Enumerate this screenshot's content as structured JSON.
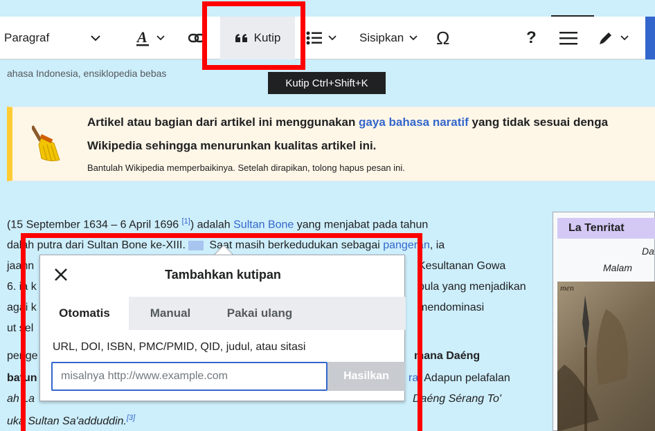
{
  "toolbar": {
    "paragraph_label": "Paragraf",
    "cite_label": "Kutip",
    "insert_label": "Sisipkan",
    "special_char_label": "Ω",
    "help_label": "?",
    "accent_color": "#3366cc"
  },
  "tooltip": {
    "text": "Kutip Ctrl+Shift+K"
  },
  "subtitle": "ahasa Indonesia, ensiklopedia bebas",
  "notice": {
    "line1_pre": "Artikel atau bagian dari artikel ini menggunakan ",
    "line1_link": "gaya bahasa naratif",
    "line1_post": " yang tidak sesuai denga",
    "line2": "Wikipedia sehingga menurunkan kualitas artikel ini.",
    "line3": "Bantulah Wikipedia memperbaikinya. Setelah dirapikan, tolong hapus pesan ini."
  },
  "article": {
    "line1_a": "(15 September 1634 – 6 April 1696 ",
    "line1_ref": "[1]",
    "line1_b": ") adalah ",
    "line1_link": "Sultan Bone",
    "line1_c": " yang menjabat pada tahun",
    "line2_a": "dalah putra dari Sultan Bone ke-XIII.",
    "line2_b": " Saat masih berkedudukan sebagai ",
    "line2_link": "pangeran",
    "line2_c": ", ia",
    "line3_right": "Kesultanan Gowa",
    "line3_left": "jaann",
    "line4_left": "6. ia k",
    "line4_right": "pula yang menjadikan",
    "line5_left": "agai k",
    "line5_right": "mendominasi",
    "line6_left": "ut sel",
    "line7_left": "penge",
    "line7_right": "mana Daéng",
    "line8_left": "batun",
    "line8_right_link": "ra",
    "line8_right": ". Adapun pelafalan",
    "line9_left": "ah La",
    "line9_right": "Daéng Sérang To'",
    "line10": "uka Sultan Sa'adduddin.",
    "line10_ref": "[3]"
  },
  "infobox": {
    "title": "La Tenritat",
    "line1": "Da",
    "line2": "Malam",
    "caption": "men"
  },
  "dialog": {
    "title": "Tambahkan kutipan",
    "tabs": [
      "Otomatis",
      "Manual",
      "Pakai ulang"
    ],
    "active_tab": "Otomatis",
    "label": "URL, DOI, ISBN, PMC/PMID, QID, judul, atau sitasi",
    "placeholder": "misalnya http://www.example.com",
    "generate_label": "Hasilkan"
  }
}
